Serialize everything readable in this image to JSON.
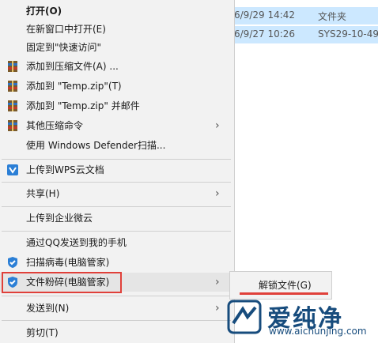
{
  "background_rows": [
    {
      "date": "6/9/29 14:42",
      "type": "文件夹"
    },
    {
      "date": "6/9/27 10:26",
      "type": "SYS29-10-49"
    }
  ],
  "menu": {
    "open": "打开(O)",
    "open_new_window": "在新窗口中打开(E)",
    "pin_quick_access": "固定到\"快速访问\"",
    "add_to_archive": "添加到压缩文件(A) ...",
    "add_to_temp_zip": "添加到 \"Temp.zip\"(T)",
    "add_to_temp_zip_email": "添加到 \"Temp.zip\" 并邮件",
    "other_compress": "其他压缩命令",
    "defender_scan": "使用 Windows Defender扫描...",
    "upload_wps": "上传到WPS云文档",
    "share": "共享(H)",
    "upload_enterprise": "上传到企业微云",
    "send_qq": "通过QQ发送到我的手机",
    "scan_virus": "扫描病毒(电脑管家)",
    "file_shred": "文件粉碎(电脑管家)",
    "send_to": "发送到(N)",
    "cut": "剪切(T)"
  },
  "submenu": {
    "unlock_file": "解锁文件(G)"
  },
  "icons": {
    "arrow": "›",
    "archive_icon": "archive-icon",
    "wps_icon": "wps-cloud-icon",
    "guard_icon": "shield-icon"
  },
  "watermark": {
    "title": "爱纯净",
    "url": "www.aichunjing.com"
  },
  "colors": {
    "highlight_box": "#e0403a",
    "selection_bg": "#cce8ff",
    "brand": "#174c7d"
  }
}
